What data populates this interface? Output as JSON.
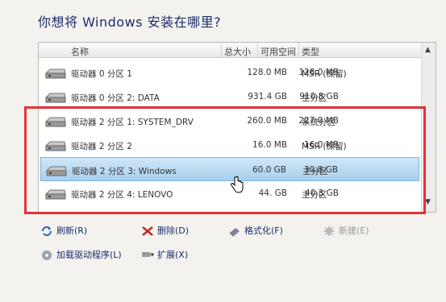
{
  "title": "你想将 Windows 安装在哪里?",
  "columns": {
    "name": "名称",
    "total": "总大小",
    "free": "可用空间",
    "type": "类型"
  },
  "rows": [
    {
      "name": "驱动器 0 分区 1",
      "total": "128.0 MB",
      "free": "128.0 MB",
      "type": "MSR (保留)"
    },
    {
      "name": "驱动器 0 分区 2: DATA",
      "total": "931.4 GB",
      "free": "910.8 GB",
      "type": "主分区"
    },
    {
      "name": "驱动器 2 分区 1: SYSTEM_DRV",
      "total": "260.0 MB",
      "free": "227.0 MB",
      "type": "系统分区"
    },
    {
      "name": "驱动器 2 分区 2",
      "total": "16.0 MB",
      "free": "16.0 MB",
      "type": "MSR (保留)"
    },
    {
      "name": "驱动器 2 分区 3: Windows",
      "total": "60.0 GB",
      "free": "30.8 GB",
      "type": "主分区"
    },
    {
      "name": "驱动器 2 分区 4: LENOVO",
      "total": "44.  GB",
      "free": "40.3 GB",
      "type": "主分区"
    }
  ],
  "selected_row": 4,
  "actions": {
    "refresh": "刷新(R)",
    "delete": "删除(D)",
    "format": "格式化(F)",
    "new": "新建(E)",
    "load_driver": "加载驱动程序(L)",
    "extend": "扩展(X)"
  },
  "icons": [
    "refresh-icon",
    "delete-icon",
    "format-icon",
    "new-icon",
    "load-driver-icon",
    "extend-icon",
    "disk-icon",
    "scroll-up-icon",
    "scroll-down-icon",
    "hand-cursor-icon"
  ],
  "colors": {
    "title": "#1b2d6a",
    "highlight_box": "#e53238",
    "selection": "#a9d0ee"
  }
}
